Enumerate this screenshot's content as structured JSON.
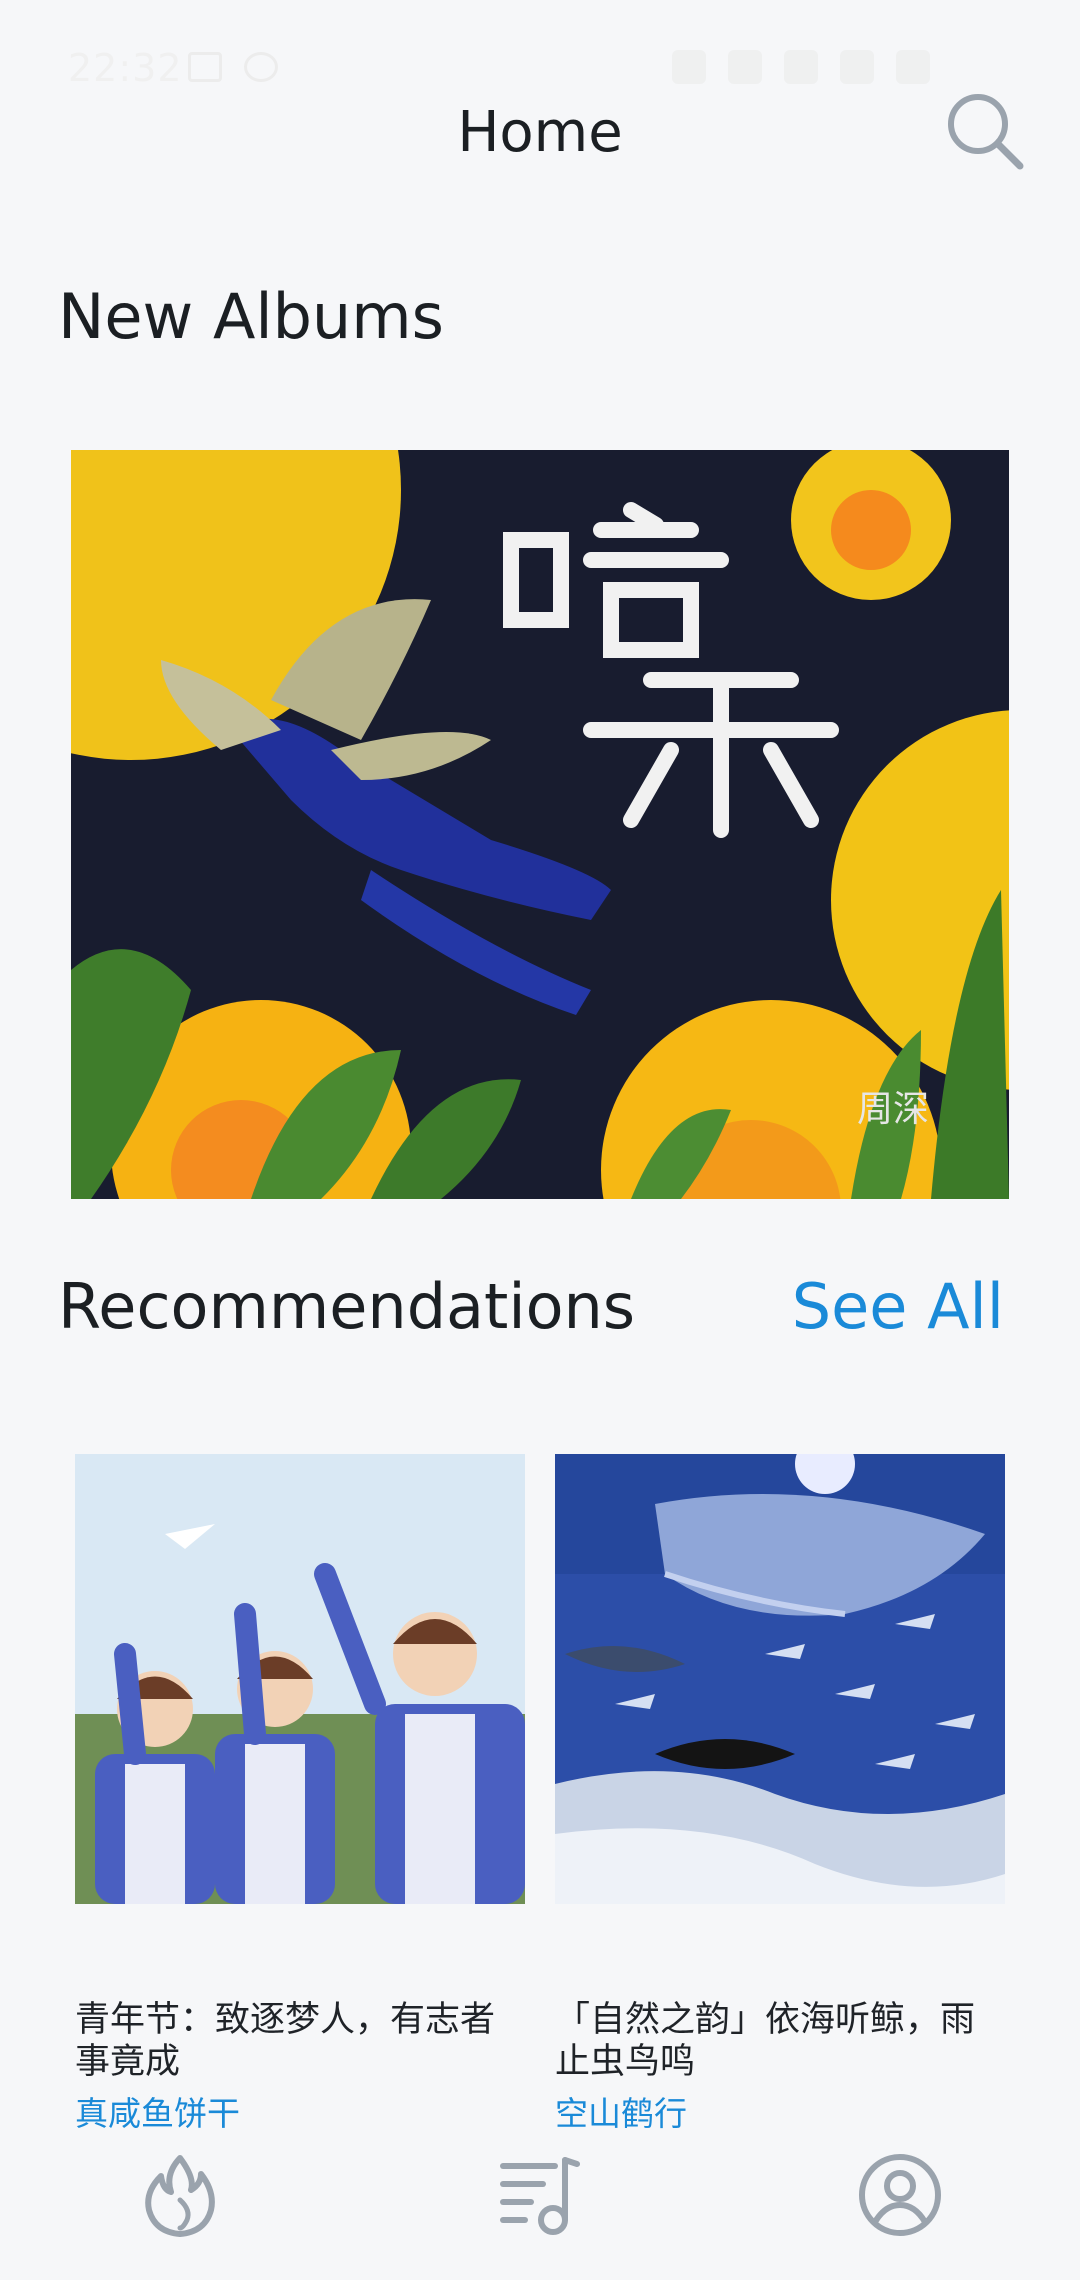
{
  "status_bar": {
    "time": "22:32"
  },
  "header": {
    "title": "Home",
    "search_icon": "search-icon"
  },
  "new_albums": {
    "section_title": "New Albums",
    "featured": {
      "title_text": "暗示",
      "artist": "周深"
    }
  },
  "recommendations": {
    "section_title": "Recommendations",
    "see_all_label": "See All",
    "items": [
      {
        "title": "青年节：致逐梦人，有志者事竟成",
        "author": "真咸鱼饼干"
      },
      {
        "title": "「自然之韵」依海听鲸，雨止虫鸟鸣",
        "author": "空山鹤行"
      }
    ]
  },
  "bottom_nav": {
    "items": [
      {
        "icon": "flame-icon"
      },
      {
        "icon": "playlist-icon"
      },
      {
        "icon": "profile-icon"
      }
    ]
  },
  "colors": {
    "accent": "#1a8ad8",
    "background": "#f6f7f9"
  }
}
